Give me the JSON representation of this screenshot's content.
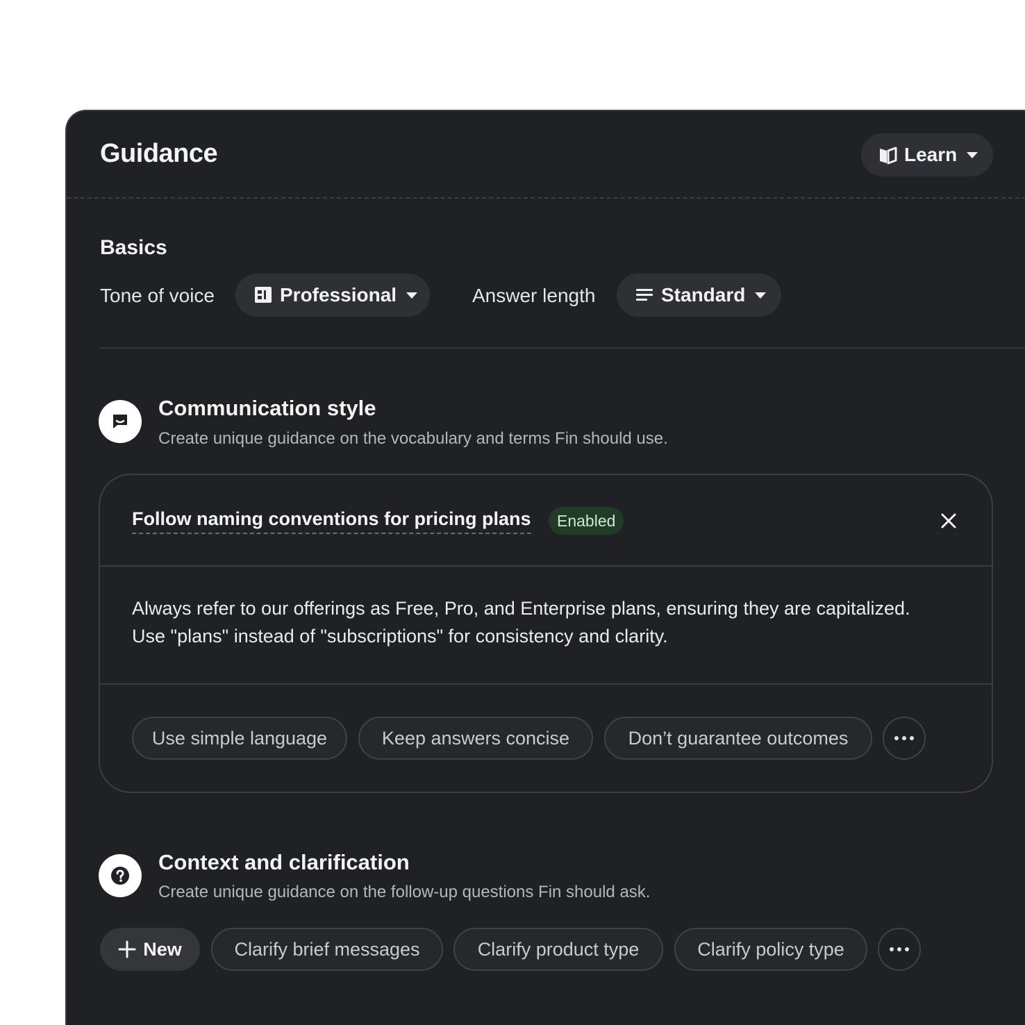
{
  "header": {
    "title": "Guidance",
    "learn_label": "Learn"
  },
  "basics": {
    "title": "Basics",
    "tone_label": "Tone of voice",
    "tone_value": "Professional",
    "length_label": "Answer length",
    "length_value": "Standard"
  },
  "communication": {
    "title": "Communication style",
    "description": "Create unique guidance on the vocabulary and terms Fin should use.",
    "rule": {
      "title": "Follow naming conventions for pricing plans",
      "status": "Enabled",
      "status_color": "#223b28",
      "body_line1": "Always refer to our offerings as Free, Pro, and Enterprise plans, ensuring they are capitalized.",
      "body_line2": "Use \"plans\" instead of \"subscriptions\" for consistency and clarity."
    },
    "chips": [
      "Use simple language",
      "Keep answers concise",
      "Don’t guarantee outcomes"
    ]
  },
  "context": {
    "title": "Context and clarification",
    "description": "Create unique guidance on the follow-up questions Fin should ask.",
    "new_label": "New",
    "chips": [
      "Clarify brief messages",
      "Clarify product type",
      "Clarify policy type"
    ]
  },
  "icons": {
    "learn": "book-icon",
    "tone": "building-icon",
    "length": "lines-icon",
    "communication": "chat-icon",
    "context": "question-icon",
    "close": "close-icon",
    "more": "more-icon",
    "new": "plus-icon"
  }
}
